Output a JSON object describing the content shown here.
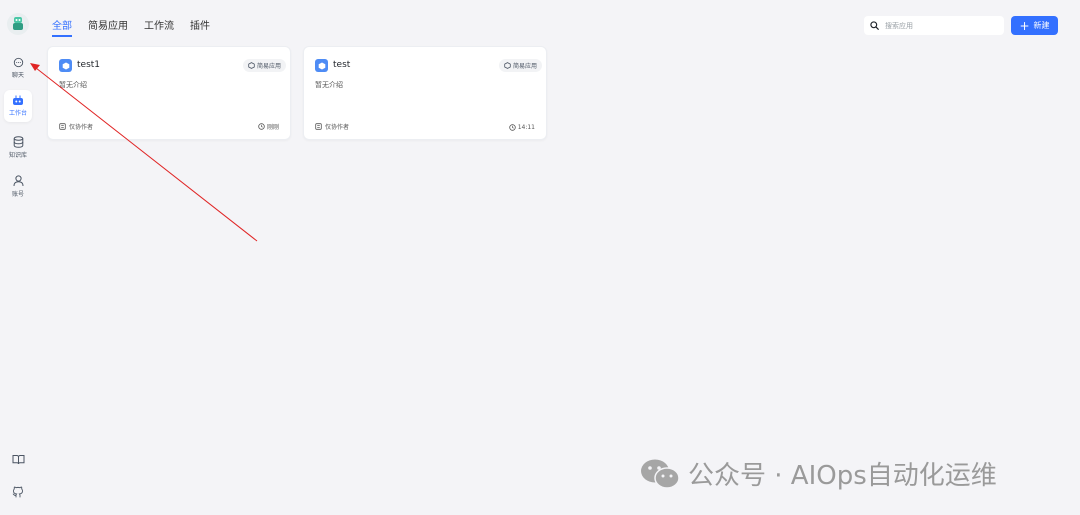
{
  "sidebar": {
    "items": [
      {
        "label": "聊天",
        "icon": "chat-bubble-icon"
      },
      {
        "label": "工作台",
        "icon": "robot-icon"
      },
      {
        "label": "知识库",
        "icon": "database-icon"
      },
      {
        "label": "账号",
        "icon": "user-icon"
      }
    ],
    "bottom": [
      {
        "icon": "book-icon"
      },
      {
        "icon": "github-icon"
      }
    ]
  },
  "tabs": [
    {
      "label": "全部",
      "active": true
    },
    {
      "label": "简易应用"
    },
    {
      "label": "工作流"
    },
    {
      "label": "插件"
    }
  ],
  "search": {
    "placeholder": "搜索应用"
  },
  "new_button": {
    "label": "新建"
  },
  "apps": [
    {
      "name": "test1",
      "type": "简易应用",
      "description": "暂无介绍",
      "owner": "仅协作者",
      "time": "刚刚"
    },
    {
      "name": "test",
      "type": "简易应用",
      "description": "暂无介绍",
      "owner": "仅协作者",
      "time": "14:11"
    }
  ],
  "watermark": {
    "text": "公众号 · AIOps自动化运维"
  },
  "colors": {
    "accent": "#3370ff",
    "annotation": "#e02424",
    "background": "#f4f4f7"
  }
}
